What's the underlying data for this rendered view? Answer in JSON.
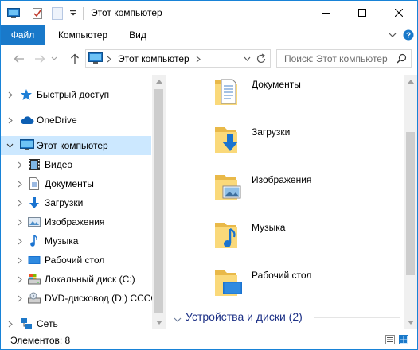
{
  "window": {
    "title": "Этот компьютер",
    "accent": "#1979ca"
  },
  "ribbon": {
    "tabs": [
      {
        "label": "Файл"
      },
      {
        "label": "Компьютер"
      },
      {
        "label": "Вид"
      }
    ]
  },
  "address": {
    "path": "Этот компьютер",
    "search_placeholder": "Поиск: Этот компьютер"
  },
  "nav": {
    "items": [
      {
        "label": "Быстрый доступ",
        "icon": "star-icon"
      },
      {
        "label": "OneDrive",
        "icon": "cloud-icon"
      },
      {
        "label": "Этот компьютер",
        "icon": "computer-icon"
      },
      {
        "label": "Видео",
        "icon": "video-icon"
      },
      {
        "label": "Документы",
        "icon": "documents-icon"
      },
      {
        "label": "Загрузки",
        "icon": "downloads-icon"
      },
      {
        "label": "Изображения",
        "icon": "pictures-icon"
      },
      {
        "label": "Музыка",
        "icon": "music-icon"
      },
      {
        "label": "Рабочий стол",
        "icon": "desktop-icon"
      },
      {
        "label": "Локальный диск (C:)",
        "icon": "drive-icon"
      },
      {
        "label": "DVD-дисковод (D:) CCCC",
        "icon": "dvd-icon"
      },
      {
        "label": "Сеть",
        "icon": "network-icon"
      }
    ]
  },
  "content": {
    "folders": [
      {
        "label": "Документы",
        "icon": "documents-folder-icon"
      },
      {
        "label": "Загрузки",
        "icon": "downloads-folder-icon"
      },
      {
        "label": "Изображения",
        "icon": "pictures-folder-icon"
      },
      {
        "label": "Музыка",
        "icon": "music-folder-icon"
      },
      {
        "label": "Рабочий стол",
        "icon": "desktop-folder-icon"
      }
    ],
    "devices_group": "Устройства и диски (2)"
  },
  "status": {
    "items_count": "Элементов: 8"
  }
}
